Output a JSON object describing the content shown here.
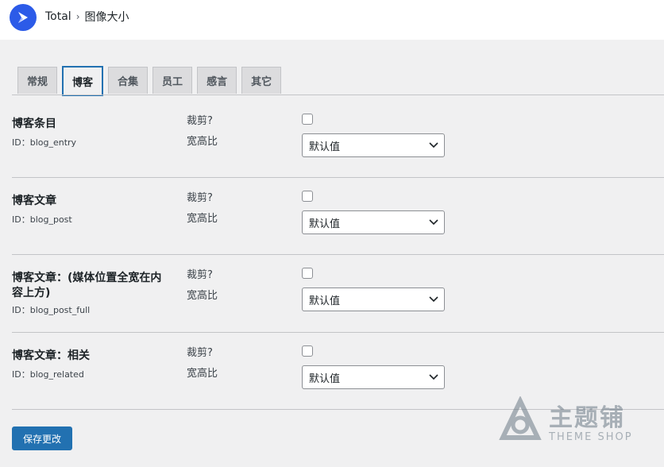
{
  "header": {
    "root": "Total",
    "separator": "›",
    "current": "图像大小"
  },
  "tabs": [
    {
      "label": "常规"
    },
    {
      "label": "博客",
      "active": true
    },
    {
      "label": "合集"
    },
    {
      "label": "员工"
    },
    {
      "label": "感言"
    },
    {
      "label": "其它"
    }
  ],
  "rows": [
    {
      "title": "博客条目",
      "id": "ID：blog_entry",
      "crop_label": "裁剪?",
      "ratio_label": "宽高比",
      "crop_checked": false,
      "ratio_value": "默认值"
    },
    {
      "title": "博客文章",
      "id": "ID：blog_post",
      "crop_label": "裁剪?",
      "ratio_label": "宽高比",
      "crop_checked": false,
      "ratio_value": "默认值"
    },
    {
      "title": "博客文章：(媒体位置全宽在内容上方)",
      "id": "ID：blog_post_full",
      "crop_label": "裁剪?",
      "ratio_label": "宽高比",
      "crop_checked": false,
      "ratio_value": "默认值"
    },
    {
      "title": "博客文章：相关",
      "id": "ID：blog_related",
      "crop_label": "裁剪?",
      "ratio_label": "宽高比",
      "crop_checked": false,
      "ratio_value": "默认值"
    }
  ],
  "save_label": "保存更改",
  "watermark": {
    "line1": "主题铺",
    "line2": "THEME SHOP"
  },
  "colors": {
    "accent": "#2271b1",
    "logo": "#2c5be8",
    "background": "#f0f0f1"
  }
}
